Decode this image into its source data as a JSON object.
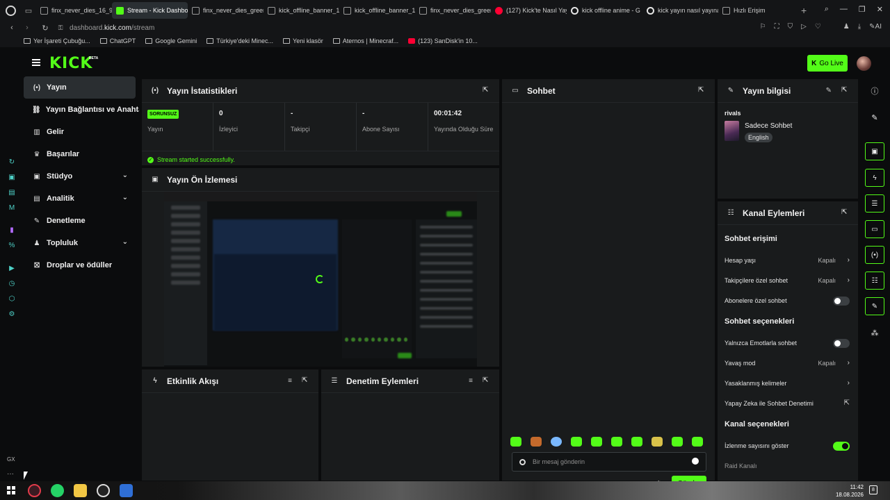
{
  "browser": {
    "tabs": [
      {
        "label": "finx_never_dies_16_9.j",
        "icon": "file-icon"
      },
      {
        "label": "Stream - Kick Dashboard",
        "icon": "kick-icon",
        "active": true
      },
      {
        "label": "finx_never_dies_green",
        "icon": "file-icon"
      },
      {
        "label": "kick_offline_banner_16",
        "icon": "file-icon"
      },
      {
        "label": "kick_offline_banner_16",
        "icon": "file-icon"
      },
      {
        "label": "finx_never_dies_green",
        "icon": "file-icon"
      },
      {
        "label": "(127) Kick'te Nasıl Yay",
        "icon": "youtube-icon"
      },
      {
        "label": "kick offline anime - G",
        "icon": "google-icon"
      },
      {
        "label": "kick yayın nasıl yayına",
        "icon": "google-icon"
      },
      {
        "label": "Hızlı Erişim",
        "icon": "grid-icon"
      }
    ],
    "url_prefix": "dashboard.",
    "url_domain": "kick.com",
    "url_path": "/stream",
    "ai_label": "AI",
    "bookmarks": [
      {
        "label": "Yer İşareti Çubuğu...",
        "icon": "folder-icon"
      },
      {
        "label": "ChatGPT",
        "icon": "chatgpt-icon"
      },
      {
        "label": "Google Gemini",
        "icon": "file-icon"
      },
      {
        "label": "Türkiye'deki Minec...",
        "icon": "globe-icon"
      },
      {
        "label": "Yeni klasör",
        "icon": "folder-icon"
      },
      {
        "label": "Aternos | Minecraf...",
        "icon": "aternos-icon"
      },
      {
        "label": "(123) SanDisk'in 10...",
        "icon": "youtube-icon"
      }
    ],
    "side_gx": "GX"
  },
  "header": {
    "logo": "KICK",
    "beta": "BETA",
    "go_live": "Go Live",
    "accent": "#53fc18"
  },
  "sidebar": {
    "items": [
      {
        "label": "Yayın",
        "icon": "broadcast-icon",
        "active": true
      },
      {
        "label": "Yayın Bağlantısı ve Anahtar",
        "icon": "link-icon"
      },
      {
        "label": "Gelir",
        "icon": "chart-icon"
      },
      {
        "label": "Başarılar",
        "icon": "trophy-icon"
      },
      {
        "label": "Stüdyo",
        "icon": "studio-icon",
        "expandable": true
      },
      {
        "label": "Analitik",
        "icon": "bar-chart-icon",
        "expandable": true
      },
      {
        "label": "Denetleme",
        "icon": "wrench-icon"
      },
      {
        "label": "Topluluk",
        "icon": "users-icon",
        "expandable": true
      },
      {
        "label": "Droplar ve ödüller",
        "icon": "gift-icon"
      }
    ]
  },
  "stats": {
    "title": "Yayın İstatistikleri",
    "status_badge": "SORUNSUZ",
    "status_label": "Yayın",
    "viewers_value": "0",
    "viewers_label": "İzleyici",
    "followers_value": "-",
    "followers_label": "Takipçi",
    "subs_value": "-",
    "subs_label": "Abone Sayısı",
    "uptime_value": "00:01:42",
    "uptime_label": "Yayında Olduğu Süre",
    "success_message": "Stream started successfully."
  },
  "preview": {
    "title": "Yayın Ön İzlemesi"
  },
  "activity": {
    "title": "Etkinlik Akışı"
  },
  "mod_actions": {
    "title": "Denetim Eylemleri"
  },
  "chat": {
    "title": "Sohbet",
    "input_placeholder": "Bir mesaj gönderin",
    "send_label": "Gönder"
  },
  "stream_info": {
    "title": "Yayın bilgisi",
    "channel_name": "rivals",
    "category": "Sadece Sohbet",
    "language": "English"
  },
  "channel_actions": {
    "title": "Kanal Eylemleri",
    "chat_access_title": "Sohbet erişimi",
    "account_age_label": "Hesap yaşı",
    "account_age_value": "Kapalı",
    "followers_only_label": "Takipçilere özel sohbet",
    "followers_only_value": "Kapalı",
    "subs_only_label": "Abonelere özel sohbet",
    "subs_only_on": false,
    "chat_options_title": "Sohbet seçenekleri",
    "emote_only_label": "Yalnızca Emotlarla sohbet",
    "emote_only_on": false,
    "slow_mode_label": "Yavaş mod",
    "slow_mode_value": "Kapalı",
    "banned_words_label": "Yasaklanmış kelimeler",
    "ai_mod_label": "Yapay Zeka ile Sohbet Denetimi",
    "channel_options_title": "Kanal seçenekleri",
    "show_viewers_label": "İzlenme sayısını göster",
    "show_viewers_on": true,
    "raid_label": "Raid Kanalı"
  },
  "taskbar": {
    "time": "11:42",
    "date": "18.08.2026",
    "notifications": "8"
  }
}
